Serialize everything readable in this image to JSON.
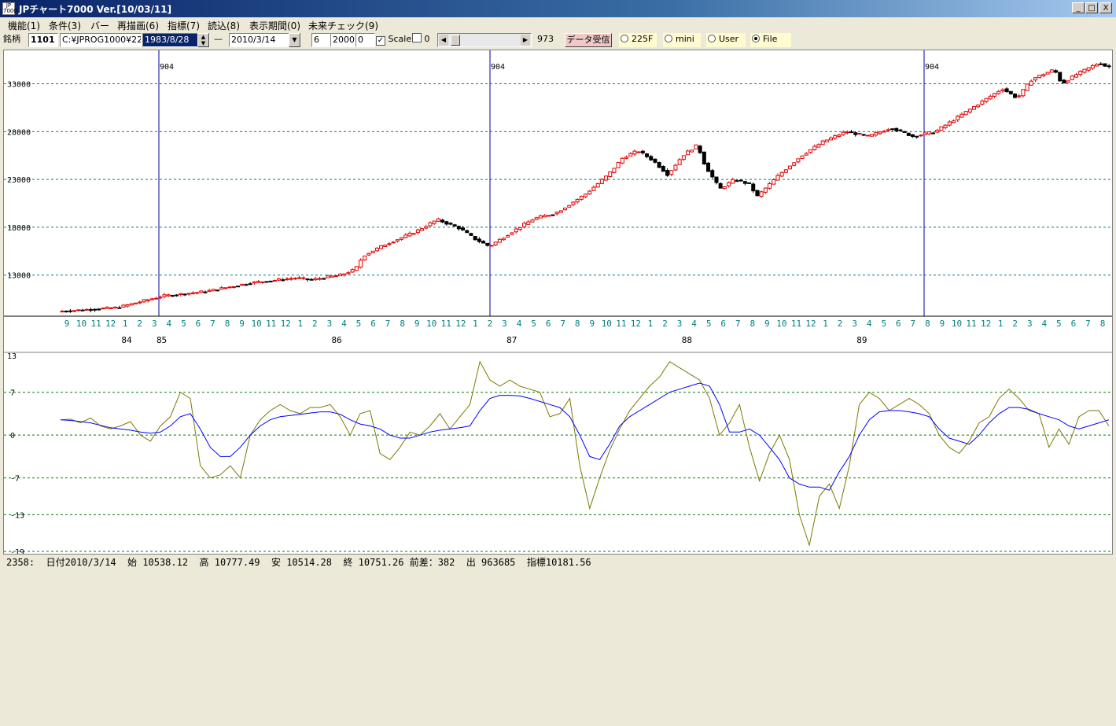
{
  "window": {
    "icon_text": "JP 7000",
    "title": "JPチャート7000 Ver.[10/03/11]",
    "buttons": {
      "minimize": "_",
      "maximize": "□",
      "close": "X"
    }
  },
  "menu": [
    "機能(1)",
    "条件(3)",
    "バー",
    "再描画(6)",
    "指標(7)",
    "読込(8)",
    "表示期間(0)",
    "未来チェック(9)"
  ],
  "toolbar": {
    "code_label": "銘柄",
    "code": "1101",
    "path": "C:¥JPROG1000¥22",
    "start_date": "1983/8/28",
    "dash": "—",
    "end_date": "2010/3/14",
    "param1": "6",
    "param2": "2000",
    "param3": "0",
    "scale_label": "Scale",
    "zero_label": "0",
    "slider_value": "973",
    "receive_button": "データ受信",
    "radios": [
      {
        "label": "225F",
        "selected": false
      },
      {
        "label": "mini",
        "selected": false
      },
      {
        "label": "User",
        "selected": false
      },
      {
        "label": "File",
        "selected": true
      }
    ]
  },
  "chart_data": [
    {
      "type": "candlestick",
      "title": "",
      "y_ticks": [
        13000,
        18000,
        23000,
        28000,
        33000
      ],
      "y_tick_labels": [
        "13000",
        "18000",
        "23000",
        "28000",
        "33000"
      ],
      "ylim": [
        8700,
        36500
      ],
      "vline_label": "904",
      "month_labels": [
        "9",
        "10",
        "11",
        "12",
        "1",
        "2",
        "3",
        "4",
        "5",
        "6",
        "7",
        "8",
        "9",
        "10",
        "11",
        "12",
        "1",
        "2",
        "3",
        "4",
        "5",
        "6",
        "7",
        "8",
        "9",
        "10",
        "11",
        "12",
        "1",
        "2",
        "3",
        "4",
        "5",
        "6",
        "7",
        "8",
        "9",
        "10",
        "11",
        "12",
        "1",
        "2",
        "3",
        "4",
        "5",
        "6",
        "7",
        "8",
        "9",
        "10",
        "11",
        "12",
        "1",
        "2",
        "3",
        "4",
        "5",
        "6",
        "7",
        "8",
        "9",
        "10",
        "11",
        "12",
        "1",
        "2",
        "3",
        "4",
        "5",
        "6",
        "7",
        "8"
      ],
      "year_labels": [
        "84",
        "85",
        "86",
        "87",
        "88",
        "89"
      ],
      "price_path": [
        [
          0,
          9200
        ],
        [
          8,
          9600
        ],
        [
          10,
          10000
        ],
        [
          14,
          10800
        ],
        [
          20,
          11300
        ],
        [
          26,
          12200
        ],
        [
          32,
          12700
        ],
        [
          34,
          12500
        ],
        [
          38,
          13000
        ],
        [
          40,
          13600
        ],
        [
          41,
          15000
        ],
        [
          44,
          16200
        ],
        [
          48,
          17500
        ],
        [
          51,
          18800
        ],
        [
          54,
          17900
        ],
        [
          56,
          16800
        ],
        [
          58,
          16000
        ],
        [
          61,
          17500
        ],
        [
          64,
          18900
        ],
        [
          67,
          19500
        ],
        [
          71,
          21500
        ],
        [
          74,
          23500
        ],
        [
          76,
          25300
        ],
        [
          78,
          26000
        ],
        [
          80,
          25000
        ],
        [
          82,
          23500
        ],
        [
          84,
          25500
        ],
        [
          86,
          26600
        ],
        [
          87,
          24500
        ],
        [
          89,
          22000
        ],
        [
          91,
          23000
        ],
        [
          93,
          22500
        ],
        [
          94,
          21200
        ],
        [
          97,
          23500
        ],
        [
          100,
          25500
        ],
        [
          103,
          27000
        ],
        [
          106,
          28000
        ],
        [
          109,
          27500
        ],
        [
          112,
          28400
        ],
        [
          115,
          27500
        ],
        [
          118,
          28000
        ],
        [
          121,
          29500
        ],
        [
          124,
          31000
        ],
        [
          127,
          32500
        ],
        [
          129,
          31500
        ],
        [
          131,
          33500
        ],
        [
          134,
          34500
        ],
        [
          135,
          33000
        ],
        [
          137,
          34000
        ],
        [
          140,
          35200
        ],
        [
          141,
          34800
        ]
      ],
      "price_path_x_unit": "weeks (approx., from Sep 1983)"
    },
    {
      "type": "line",
      "title": "",
      "y_ticks": [
        7,
        0,
        -7,
        -13,
        -19
      ],
      "y_tick_labels": [
        "7",
        "0",
        "-7",
        "-13",
        "-19"
      ],
      "top_label": "13",
      "ylim": [
        -19,
        13
      ],
      "series": [
        {
          "name": "",
          "color": "#7a7a00",
          "values": [
            2.5,
            2.6,
            2.0,
            2.8,
            1.5,
            1.0,
            1.5,
            2.2,
            0.0,
            -1.0,
            1.5,
            3.0,
            7.0,
            6.0,
            -5.0,
            -7.0,
            -6.5,
            -5.0,
            -7.0,
            0.0,
            2.5,
            4.0,
            5.0,
            4.0,
            3.5,
            4.5,
            4.5,
            5.0,
            3.0,
            0.0,
            3.5,
            4.0,
            -3.0,
            -4.0,
            -2.0,
            0.5,
            0.0,
            1.5,
            3.5,
            1.0,
            3.0,
            5.0,
            12.0,
            9.0,
            8.0,
            9.0,
            8.0,
            7.5,
            7.0,
            3.0,
            3.5,
            6.0,
            -5.0,
            -12.0,
            -7.0,
            -2.5,
            1.0,
            4.0,
            6.0,
            8.0,
            9.5,
            12.0,
            11.0,
            10.0,
            9.0,
            6.0,
            0.0,
            2.0,
            5.0,
            -2.0,
            -7.5,
            -3.0,
            0.0,
            -4.0,
            -13.0,
            -18.0,
            -10.0,
            -8.0,
            -12.0,
            -5.0,
            5.0,
            7.0,
            6.0,
            4.0,
            5.0,
            6.0,
            5.0,
            3.5,
            0.0,
            -2.0,
            -3.0,
            -1.0,
            2.0,
            3.0,
            6.0,
            7.5,
            6.0,
            4.0,
            3.5,
            -2.0,
            1.0,
            -1.5,
            3.0,
            4.0,
            4.0,
            1.5
          ]
        },
        {
          "name": "",
          "color": "#0000ff",
          "values": [
            2.5,
            2.4,
            2.2,
            2.0,
            1.6,
            1.2,
            1.0,
            0.8,
            0.5,
            0.3,
            0.5,
            1.5,
            3.0,
            3.5,
            1.0,
            -2.0,
            -3.5,
            -3.5,
            -2.0,
            0.0,
            1.5,
            2.5,
            3.0,
            3.2,
            3.4,
            3.6,
            3.8,
            3.8,
            3.4,
            2.5,
            1.8,
            1.5,
            1.0,
            0.0,
            -0.5,
            -0.5,
            0.0,
            0.5,
            0.8,
            1.0,
            1.2,
            1.5,
            4.0,
            6.0,
            6.5,
            6.5,
            6.4,
            6.0,
            5.5,
            5.0,
            4.5,
            3.0,
            0.0,
            -3.5,
            -4.0,
            -1.5,
            1.5,
            3.0,
            4.0,
            5.0,
            6.0,
            7.0,
            7.5,
            8.0,
            8.5,
            8.0,
            5.0,
            0.5,
            0.5,
            1.0,
            0.0,
            -2.0,
            -4.0,
            -7.0,
            -8.0,
            -8.5,
            -8.5,
            -9.0,
            -6.0,
            -3.5,
            0.0,
            2.5,
            3.8,
            4.0,
            4.0,
            3.8,
            3.5,
            3.0,
            1.0,
            -0.5,
            -1.0,
            -1.5,
            0.0,
            2.0,
            3.5,
            4.5,
            4.5,
            4.2,
            3.5,
            3.0,
            2.5,
            1.5,
            1.0,
            1.5,
            2.0,
            2.5
          ]
        }
      ]
    }
  ],
  "status": {
    "text": "2358:  日付2010/3/14  始 10538.12  高 10777.49  安 10514.28  終 10751.26 前差：382  出 963685  指標10181.56"
  }
}
